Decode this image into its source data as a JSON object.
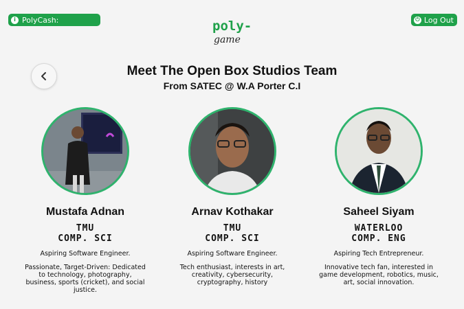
{
  "header": {
    "polycash_label": "PolyCash:",
    "logout_label": "Log Out",
    "logo_top": "poly-",
    "logo_bottom": "game"
  },
  "page": {
    "title": "Meet The Open Box Studios Team",
    "subtitle": "From SATEC @ W.A Porter C.I"
  },
  "team": [
    {
      "name": "Mustafa Adnan",
      "school": "TMU",
      "program": "COMP. SCI",
      "role": "Aspiring Software Engineer.",
      "description": "Passionate, Target-Driven: Dedicated to technology, photography, business, sports (cricket), and social justice."
    },
    {
      "name": "Arnav Kothakar",
      "school": "TMU",
      "program": "COMP. SCI",
      "role": "Aspiring Software Engineer.",
      "description": "Tech enthusiast, interests in art, creativity, cybersecurity, cryptography, history"
    },
    {
      "name": "Saheel Siyam",
      "school": "WATERLOO",
      "program": "COMP. ENG",
      "role": "Aspiring Tech Entrepreneur.",
      "description": "Innovative tech fan, interested in game development, robotics, music, art, social innovation."
    }
  ],
  "colors": {
    "accent": "#1fa14a",
    "avatar_ring": "#2fb36d",
    "background": "#f4f4f4"
  },
  "icons": {
    "polycash": "info-icon",
    "logout": "power-icon",
    "back": "chevron-left-icon"
  }
}
